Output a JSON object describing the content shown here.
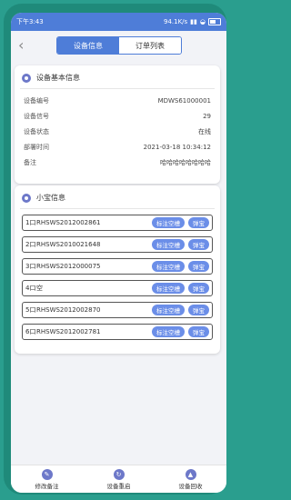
{
  "status": {
    "time": "下午3:43",
    "speed": "94.1K/s"
  },
  "header": {
    "back": "‹",
    "tab_info": "设备信息",
    "tab_orders": "订单列表"
  },
  "basic": {
    "title": "设备基本信息",
    "rows": [
      {
        "label": "设备编号",
        "value": "MDWS61000001"
      },
      {
        "label": "设备信号",
        "value": "29"
      },
      {
        "label": "设备状态",
        "value": "在线"
      },
      {
        "label": "部署时间",
        "value": "2021-03-18 10:34:12"
      },
      {
        "label": "备注",
        "value": "哈哈哈哈哈哈哈哈"
      }
    ]
  },
  "slots": {
    "title": "小宝信息",
    "btn_mark": "标注空槽",
    "btn_eject": "弹宝",
    "items": [
      {
        "num": "1口",
        "code": "RHSWS2012002861"
      },
      {
        "num": "2口",
        "code": "RHSWS2010021648"
      },
      {
        "num": "3口",
        "code": "RHSWS2012000075"
      },
      {
        "num": "4口",
        "code": "空"
      },
      {
        "num": "5口",
        "code": "RHSWS2012002870"
      },
      {
        "num": "6口",
        "code": "RHSWS2012002781"
      }
    ]
  },
  "bottom": {
    "edit": "修改备注",
    "restart": "设备重启",
    "recycle": "设备回收"
  },
  "colors": {
    "accent": "#4e7dd8",
    "pill": "#6b8ee8"
  }
}
